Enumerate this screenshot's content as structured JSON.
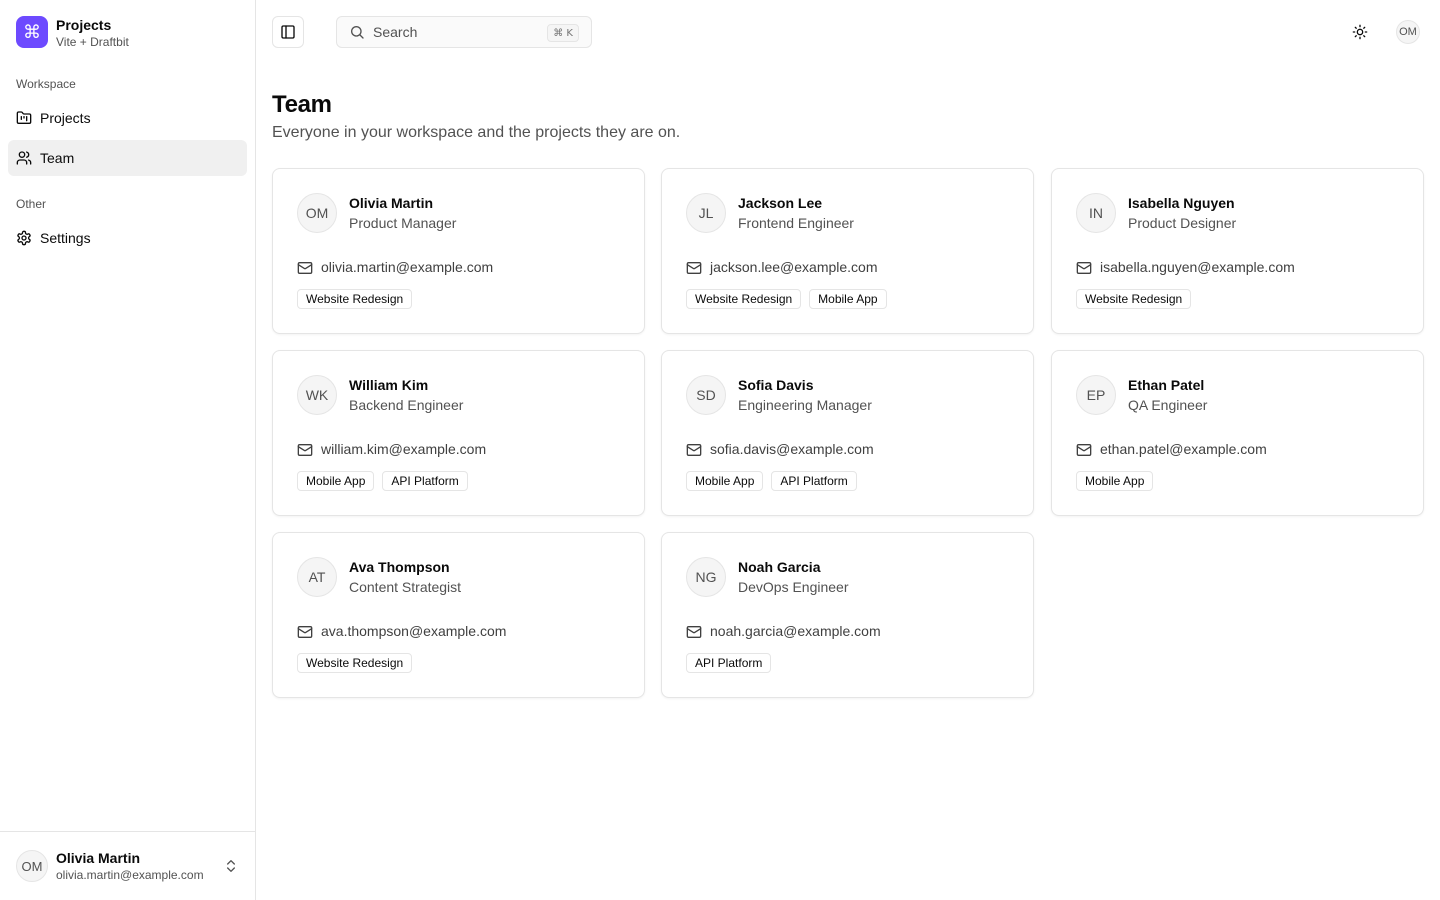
{
  "brand": {
    "logo_glyph": "⌘",
    "title": "Projects",
    "subtitle": "Vite + Draftbit",
    "accent": "#6d4aff"
  },
  "sidebar": {
    "groups": [
      {
        "label": "Workspace",
        "items": [
          {
            "label": "Projects",
            "icon": "folder-icon",
            "active": false
          },
          {
            "label": "Team",
            "icon": "users-icon",
            "active": true
          }
        ]
      },
      {
        "label": "Other",
        "items": [
          {
            "label": "Settings",
            "icon": "gear-icon",
            "active": false
          }
        ]
      }
    ],
    "user": {
      "initials": "OM",
      "name": "Olivia Martin",
      "email": "olivia.martin@example.com"
    }
  },
  "header": {
    "search_placeholder": "Search",
    "search_shortcut": "⌘ K",
    "avatar_initials": "OM"
  },
  "page": {
    "title": "Team",
    "subtitle": "Everyone in your workspace and the projects they are on."
  },
  "members": [
    {
      "initials": "OM",
      "name": "Olivia Martin",
      "role": "Product Manager",
      "email": "olivia.martin@example.com",
      "projects": [
        "Website Redesign"
      ]
    },
    {
      "initials": "JL",
      "name": "Jackson Lee",
      "role": "Frontend Engineer",
      "email": "jackson.lee@example.com",
      "projects": [
        "Website Redesign",
        "Mobile App"
      ]
    },
    {
      "initials": "IN",
      "name": "Isabella Nguyen",
      "role": "Product Designer",
      "email": "isabella.nguyen@example.com",
      "projects": [
        "Website Redesign"
      ]
    },
    {
      "initials": "WK",
      "name": "William Kim",
      "role": "Backend Engineer",
      "email": "william.kim@example.com",
      "projects": [
        "Mobile App",
        "API Platform"
      ]
    },
    {
      "initials": "SD",
      "name": "Sofia Davis",
      "role": "Engineering Manager",
      "email": "sofia.davis@example.com",
      "projects": [
        "Mobile App",
        "API Platform"
      ]
    },
    {
      "initials": "EP",
      "name": "Ethan Patel",
      "role": "QA Engineer",
      "email": "ethan.patel@example.com",
      "projects": [
        "Mobile App"
      ]
    },
    {
      "initials": "AT",
      "name": "Ava Thompson",
      "role": "Content Strategist",
      "email": "ava.thompson@example.com",
      "projects": [
        "Website Redesign"
      ]
    },
    {
      "initials": "NG",
      "name": "Noah Garcia",
      "role": "DevOps Engineer",
      "email": "noah.garcia@example.com",
      "projects": [
        "API Platform"
      ]
    }
  ]
}
